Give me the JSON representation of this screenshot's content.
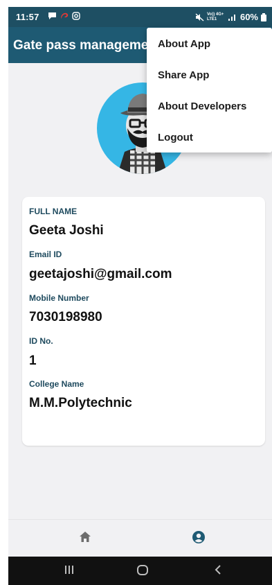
{
  "status_bar": {
    "time": "11:57",
    "network_text": "Vo)) 4G+ LTE1",
    "battery": "60%"
  },
  "app_bar": {
    "title": "Gate pass manageme"
  },
  "menu": {
    "items": [
      {
        "label": "About App"
      },
      {
        "label": "Share App"
      },
      {
        "label": "About Developers"
      },
      {
        "label": "Logout"
      }
    ]
  },
  "profile": {
    "avatar_icon": "hipster-avatar-icon",
    "fields": [
      {
        "label": "FULL NAME",
        "value": "Geeta Joshi"
      },
      {
        "label": "Email ID",
        "value": "geetajoshi@gmail.com"
      },
      {
        "label": "Mobile Number",
        "value": "7030198980"
      },
      {
        "label": "ID No.",
        "value": "1"
      },
      {
        "label": "College Name",
        "value": "M.M.Polytechnic"
      }
    ]
  },
  "bottom_nav": {
    "items": [
      {
        "icon": "home-icon",
        "active": false
      },
      {
        "icon": "account-circle-icon",
        "active": true
      }
    ]
  },
  "system_nav": {
    "buttons": [
      "recents-icon",
      "home-circle-icon",
      "back-icon"
    ]
  },
  "colors": {
    "app_bar": "#1e5a73",
    "status_bar": "#1e4f63",
    "label": "#1e4a5e",
    "active_nav": "#1e5a73",
    "avatar_bg": "#35b6e5"
  }
}
